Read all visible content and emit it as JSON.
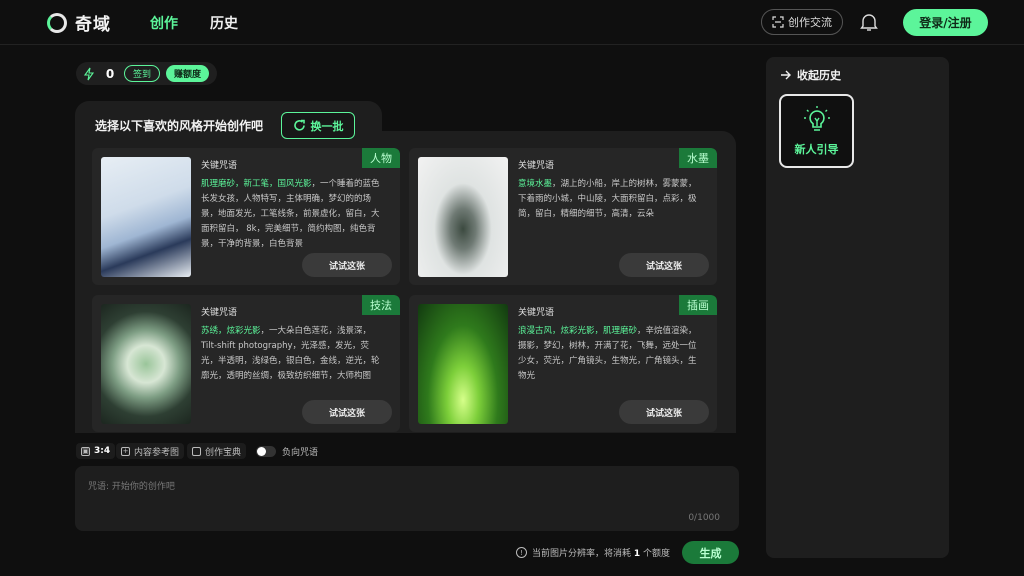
{
  "app": {
    "brand": "奇域"
  },
  "nav": {
    "create": "创作",
    "history": "历史"
  },
  "header": {
    "community_label": "创作交流",
    "login_label": "登录/注册"
  },
  "credits": {
    "value": "0",
    "checkin_label": "签到",
    "earn_label": "赚额度"
  },
  "panel": {
    "title": "选择以下喜欢的风格开始创作吧",
    "refresh_label": "换一批",
    "cards": [
      {
        "tag": "人物",
        "keyword_title": "关键咒语",
        "highlight": "肌理磨砂，新工笔，国风光影",
        "desc": "，一个睡着的蓝色长发女孩，人物特写，主体明确，梦幻的的场景，地面发光，工笔线条，前景虚化，留白，大面积留白， 8k，完美细节，简约构图，纯色背景，干净的背景，白色背景",
        "try_label": "试试这张"
      },
      {
        "tag": "水墨",
        "keyword_title": "关键咒语",
        "highlight": "意境水墨",
        "desc": "，湖上的小船，岸上的树林，雾蒙蒙，下着雨的小城，中山陵，大面积留白，点彩，极简，留白，精细的细节，高清，云朵",
        "try_label": "试试这张"
      },
      {
        "tag": "技法",
        "keyword_title": "关键咒语",
        "highlight": "苏绣，炫彩光影",
        "desc": "，一大朵白色莲花，浅景深，Tilt-shift photography，光泽感，发光，荧光，半透明，浅绿色，银白色，金线，逆光，轮廓光，透明的丝绸，极致纺织细节，大师构图",
        "try_label": "试试这张"
      },
      {
        "tag": "插画",
        "keyword_title": "关键咒语",
        "highlight": "浪漫古风，炫彩光影，肌理磨砂",
        "desc": "，辛烷值渲染，摄影，梦幻，树林，开满了花，飞舞，远处一位少女，荧光，广角镜头，生物光，广角镜头，生物光",
        "try_label": "试试这张"
      }
    ]
  },
  "toolbar": {
    "ratio": "3:4",
    "reference": "内容参考图",
    "treasure": "创作宝典",
    "negative": "负向咒语"
  },
  "prompt": {
    "placeholder": "咒语: 开始你的创作吧",
    "counter": "0/1000"
  },
  "footer": {
    "notice_prefix": "当前图片分辨率，将消耗 ",
    "notice_cost": "1",
    "notice_suffix": " 个额度",
    "generate_label": "生成"
  },
  "sidebar": {
    "title": "收起历史",
    "guide_label": "新人引导"
  },
  "colors": {
    "accent": "#5cf59a",
    "accent_dark": "#1b7a3a",
    "background": "#0f0f0f",
    "panel": "#1e1e1e"
  }
}
